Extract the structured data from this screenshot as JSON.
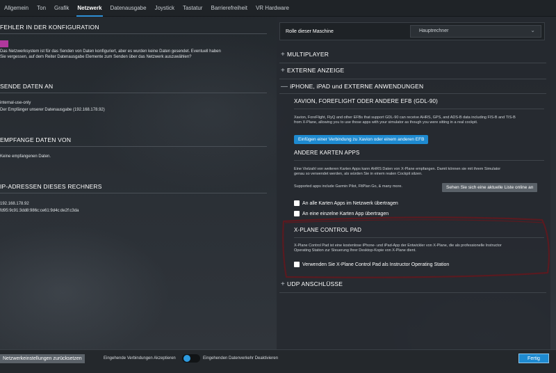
{
  "tabs": [
    {
      "label": "Allgemein"
    },
    {
      "label": "Ton"
    },
    {
      "label": "Grafik"
    },
    {
      "label": "Netzwerk"
    },
    {
      "label": "Datenausgabe"
    },
    {
      "label": "Joystick"
    },
    {
      "label": "Tastatur"
    },
    {
      "label": "Barrierefreiheit"
    },
    {
      "label": "VR Hardware"
    }
  ],
  "active_tab": "Netzwerk",
  "left": {
    "config_error": {
      "title": "FEHLER IN DER KONFIGURATION",
      "text1": "Das Netzwerksystem ist für das Senden von Daten konfiguriert, aber es wurden keine Daten gesendet. Eventuell haben",
      "text2": "Sie vergessen, auf dem Reiter Datenausgabe Elemente zum Senden über das Netzwerk auszuwählen?",
      "swatch_color": "#b0389c"
    },
    "send": {
      "title": "SENDE DATEN AN",
      "line1": "internal-use-only",
      "line2": "Der Empfänger unserer Datenausgabe (192.168.178.92)"
    },
    "receive": {
      "title": "EMPFANGE DATEN VON",
      "line1": "Keine empfangenen Daten."
    },
    "ip": {
      "title": "IP-ADRESSEN DIESES RECHNERS",
      "line1": "192.168.178.92",
      "line2": "fd95:9c91:3dd8:986c:ce61:9d4c:de2f:c3da"
    }
  },
  "right": {
    "role_label": "Rolle dieser Maschine",
    "role_value": "Hauptrechner",
    "multiplayer": "MULTIPLAYER",
    "external_display": "EXTERNE ANZEIGE",
    "iphone": "iPHONE, iPAD und EXTERNE ANWENDUNGEN",
    "xavion": {
      "title": "XAVION, FOREFLIGHT ODER ANDERE EFB (GDL-90)",
      "text1": "Xavion, ForeFlight, FlyQ and other EFBs that support GDL-90 can receive AHRS, GPS, and ADS-B data including FIS-B and TIS-B",
      "text2": "from X-Plane, allowing you to use those apps with your simulator as though you were sitting in a real cockpit.",
      "button": "Einfügen einer Verbindung zu Xavion oder einem anderen EFB"
    },
    "maps": {
      "title": "ANDERE KARTEN APPS",
      "text1": "Eine Vielzahl von weiteren Karten Apps kann AHRS Daten von X-Plane empfangen. Damit können sie mit ihrem Simulator",
      "text2": "genau so verwendet werden, als würden Sie in einem realen Cockpit sitzen.",
      "supported": "Supported apps include Garmin Pilot, FltPlan Go, & many more.",
      "list_button": "Sehen Sie sich eine aktuelle Liste online an",
      "cb_all": "An alle Karten Apps im Netzwerk übertragen",
      "cb_single": "An eine einzelne Karten App übertragen"
    },
    "control_pad": {
      "title": "X-PLANE CONTROL PAD",
      "text1": "X-Plane Control Pad ist eine kostenlose iPhone- und iPad-App der Entwickler von X-Plane, die als professionelle Instructor",
      "text2": "Operating Station zur Steuerung Ihrer Desktop-Kopie von X-Plane dient.",
      "cb_label": "Verwenden Sie X-Plane Control Pad als Instructor Operating Station"
    },
    "udp": "UDP ANSCHLÜSSE",
    "plus": "+",
    "minus": "—"
  },
  "bottom": {
    "reset": "Netzwerkeinstellungen zurücksetzen",
    "accept": "Eingehende Verbindungen Akzeptieren",
    "deactivated": "Eingehenden Datenverkehr Deaktivieren",
    "done": "Fertig"
  },
  "colors": {
    "accent": "#1e8ad0",
    "annotation": "#5a1a20"
  }
}
